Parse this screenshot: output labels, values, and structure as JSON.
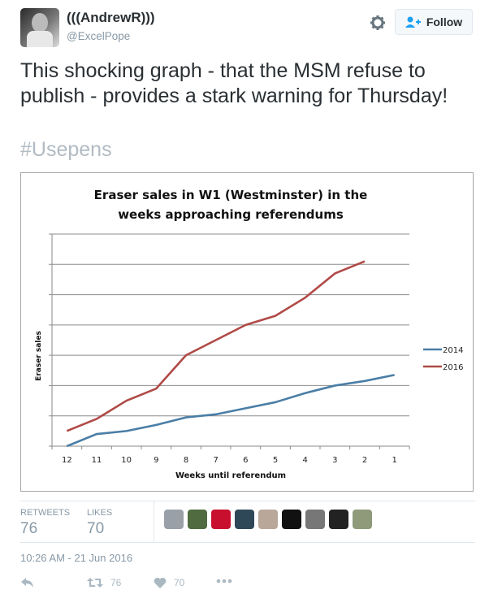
{
  "user": {
    "display_name": "(((AndrewR)))",
    "handle": "@ExcelPope",
    "avatar_icon": "avatar-image"
  },
  "header": {
    "settings_icon": "gear-icon",
    "follow_label": "Follow",
    "follow_icon": "add-user-icon"
  },
  "tweet": {
    "text": "This shocking graph - that the MSM refuse to publish - provides a stark warning for Thursday!",
    "hashtag": "#Usepens"
  },
  "chart_data": {
    "type": "line",
    "title": "Eraser sales in W1 (Westminster) in the weeks approaching referendums",
    "xlabel": "Weeks until referendum",
    "ylabel": "Eraser sales",
    "categories": [
      "12",
      "11",
      "10",
      "9",
      "8",
      "7",
      "6",
      "5",
      "4",
      "3",
      "2",
      "1"
    ],
    "ylim": [
      0,
      7
    ],
    "y_tick_labels_shown": false,
    "grid": true,
    "legend": "right",
    "series": [
      {
        "name": "2014",
        "color": "#4a7ea6",
        "values": [
          0.0,
          0.4,
          0.5,
          0.7,
          0.95,
          1.05,
          1.25,
          1.45,
          1.75,
          2.0,
          2.15,
          2.35
        ]
      },
      {
        "name": "2016",
        "color": "#b04a47",
        "values": [
          0.5,
          0.9,
          1.5,
          1.9,
          3.0,
          3.5,
          4.0,
          4.3,
          4.9,
          5.7,
          6.1,
          null
        ]
      }
    ]
  },
  "stats": {
    "retweets_label": "RETWEETS",
    "retweets": "76",
    "likes_label": "LIKES",
    "likes": "70",
    "likers": [
      "#9aa0a8",
      "#4f6b3f",
      "#c8102e",
      "#2f4858",
      "#b9a79a",
      "#111111",
      "#777777",
      "#222222",
      "#8e9a7a"
    ]
  },
  "timestamp": "10:26 AM - 21 Jun 2016",
  "actions": {
    "reply_icon": "reply-icon",
    "retweet_icon": "retweet-icon",
    "retweet_count": "76",
    "like_icon": "heart-icon",
    "like_count": "70",
    "more_icon": "more-icon"
  }
}
